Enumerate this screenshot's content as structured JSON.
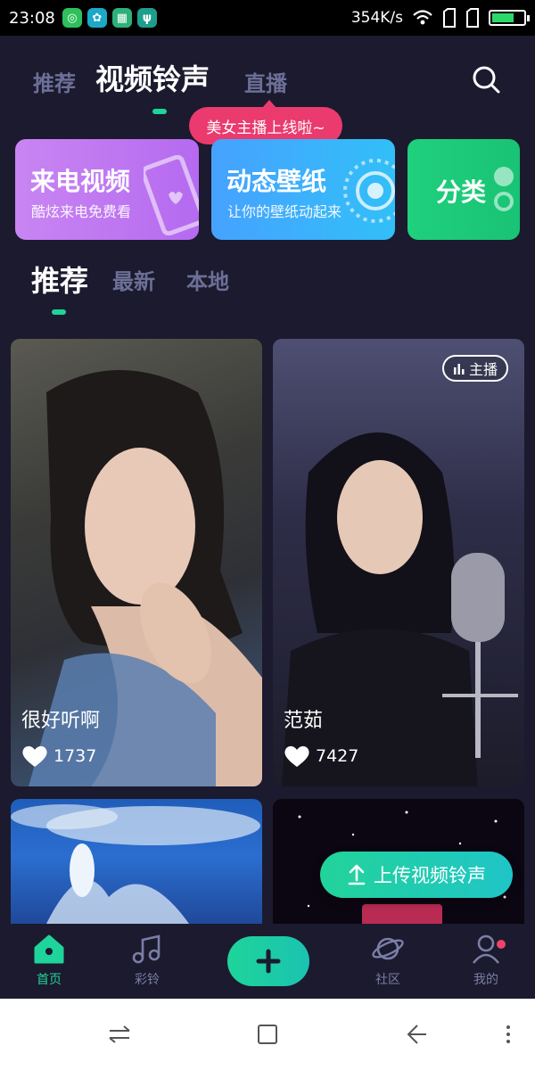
{
  "status_bar": {
    "time": "23:08",
    "network_speed": "354K/s",
    "battery_level_percent": 70,
    "app_icons": [
      "app-icon-green",
      "app-icon-teal",
      "app-icon-image",
      "usb-icon"
    ]
  },
  "top_tabs": [
    {
      "label": "推荐",
      "active": false
    },
    {
      "label": "视频铃声",
      "active": true
    },
    {
      "label": "直播",
      "active": false
    }
  ],
  "live_bubble": "美女主播上线啦~",
  "feature_cards": [
    {
      "title": "来电视频",
      "subtitle": "酷炫来电免费看",
      "color": "#c383f2"
    },
    {
      "title": "动态壁纸",
      "subtitle": "让你的壁纸动起来",
      "color": "#3daffb"
    },
    {
      "title": "分类",
      "subtitle": "",
      "color": "#1fcb79"
    }
  ],
  "sub_tabs": [
    {
      "label": "推荐",
      "active": true
    },
    {
      "label": "最新",
      "active": false
    },
    {
      "label": "本地",
      "active": false
    }
  ],
  "videos": [
    {
      "title": "很好听啊",
      "likes": "1737",
      "badge": ""
    },
    {
      "title": "范茹",
      "likes": "7427",
      "badge": "主播"
    },
    {
      "title": "",
      "likes": "",
      "badge": ""
    },
    {
      "title": "",
      "likes": "",
      "badge": ""
    }
  ],
  "upload_button": "上传视频铃声",
  "bottom_nav": [
    {
      "label": "首页",
      "icon": "home-icon",
      "active": true
    },
    {
      "label": "彩铃",
      "icon": "music-note-icon",
      "active": false
    },
    {
      "label": "",
      "icon": "plus-icon",
      "active": false
    },
    {
      "label": "社区",
      "icon": "planet-icon",
      "active": false
    },
    {
      "label": "我的",
      "icon": "profile-icon",
      "active": false
    }
  ],
  "colors": {
    "background": "#1b1a2e",
    "accent": "#1ed49a",
    "inactive_text": "#6c6f96",
    "bubble": "#ea3a6e"
  }
}
